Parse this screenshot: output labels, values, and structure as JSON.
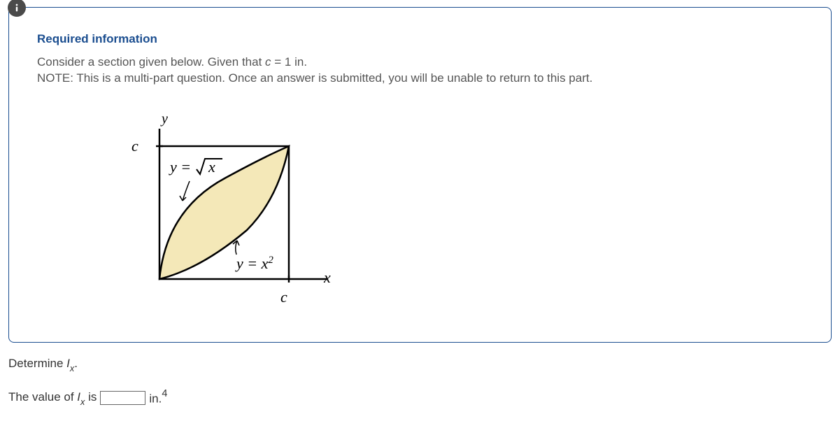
{
  "header": "Required information",
  "description_line1_pre": "Consider a section given below. Given that ",
  "description_line1_var": "c",
  "description_line1_post": " = 1 in.",
  "description_line2": "NOTE: This is a multi-part question. Once an answer is submitted, you will be unable to return to this part.",
  "diagram": {
    "y_axis": "y",
    "x_axis": "x",
    "c_label_y": "c",
    "c_label_x": "c",
    "curve1_prefix": "y = ",
    "curve1_radicand": "x",
    "curve2_prefix": "y = x",
    "curve2_exp": "2"
  },
  "prompt_pre": "Determine ",
  "prompt_var": "I",
  "prompt_sub": "x",
  "prompt_post": ".",
  "answer_pre": "The value of ",
  "answer_var": "I",
  "answer_sub": "x",
  "answer_mid": " is ",
  "answer_unit_base": "in.",
  "answer_unit_exp": "4",
  "answer_value": ""
}
